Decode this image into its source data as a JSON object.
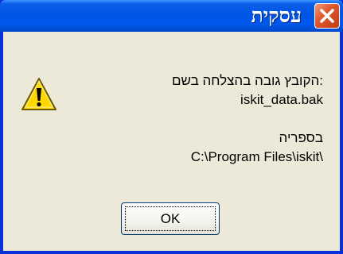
{
  "window": {
    "title": "עסקית"
  },
  "title_bar_buttons": {
    "close_icon": "close-x-icon"
  },
  "dialog": {
    "icon": "warning-triangle-icon",
    "message_line_1": ":הקובץ גובה בהצלחה בשם",
    "message_line_2": "iskit_data.bak",
    "message_line_3": "בספריה",
    "message_line_4": "C:\\Program Files\\iskit\\"
  },
  "buttons": {
    "ok_label": "OK"
  },
  "colors": {
    "titlebar": "#0054e3",
    "close_button": "#e0582e",
    "dialog_background": "#ece9d8",
    "warning_yellow": "#ffd800"
  }
}
